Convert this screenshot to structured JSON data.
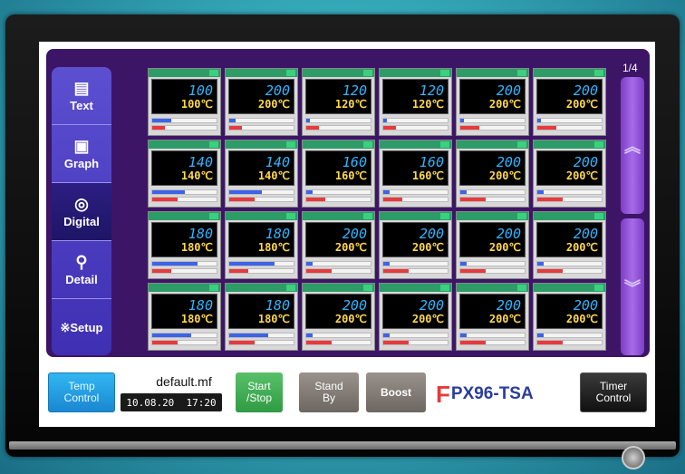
{
  "sidebar": {
    "items": [
      {
        "label": "Text",
        "icon": "text-icon",
        "glyph": "▤"
      },
      {
        "label": "Graph",
        "icon": "camera-icon",
        "glyph": "▣"
      },
      {
        "label": "Digital",
        "icon": "dial-icon",
        "glyph": "◎",
        "active": true
      },
      {
        "label": "Detail",
        "icon": "magnifier-icon",
        "glyph": "⚲"
      },
      {
        "label": "※Setup",
        "icon": "setup-icon",
        "glyph": ""
      }
    ]
  },
  "pager": {
    "page": "1/4",
    "up_glyph": "︽",
    "down_glyph": "︾"
  },
  "channels": [
    {
      "pv": "100",
      "sv": "100℃",
      "out1": 0.3,
      "out2": 0.2
    },
    {
      "pv": "200",
      "sv": "200℃",
      "out1": 0.1,
      "out2": 0.2
    },
    {
      "pv": "120",
      "sv": "120℃",
      "out1": 0.05,
      "out2": 0.2
    },
    {
      "pv": "120",
      "sv": "120℃",
      "out1": 0.05,
      "out2": 0.2
    },
    {
      "pv": "200",
      "sv": "200℃",
      "out1": 0.05,
      "out2": 0.3
    },
    {
      "pv": "200",
      "sv": "200℃",
      "out1": 0.05,
      "out2": 0.3
    },
    {
      "pv": "140",
      "sv": "140℃",
      "out1": 0.5,
      "out2": 0.4
    },
    {
      "pv": "140",
      "sv": "140℃",
      "out1": 0.5,
      "out2": 0.4
    },
    {
      "pv": "160",
      "sv": "160℃",
      "out1": 0.1,
      "out2": 0.3
    },
    {
      "pv": "160",
      "sv": "160℃",
      "out1": 0.1,
      "out2": 0.3
    },
    {
      "pv": "200",
      "sv": "200℃",
      "out1": 0.1,
      "out2": 0.4
    },
    {
      "pv": "200",
      "sv": "200℃",
      "out1": 0.1,
      "out2": 0.4
    },
    {
      "pv": "180",
      "sv": "180℃",
      "out1": 0.7,
      "out2": 0.3
    },
    {
      "pv": "180",
      "sv": "180℃",
      "out1": 0.7,
      "out2": 0.3
    },
    {
      "pv": "200",
      "sv": "200℃",
      "out1": 0.1,
      "out2": 0.4
    },
    {
      "pv": "200",
      "sv": "200℃",
      "out1": 0.1,
      "out2": 0.4
    },
    {
      "pv": "200",
      "sv": "200℃",
      "out1": 0.1,
      "out2": 0.4
    },
    {
      "pv": "200",
      "sv": "200℃",
      "out1": 0.1,
      "out2": 0.4
    },
    {
      "pv": "180",
      "sv": "180℃",
      "out1": 0.6,
      "out2": 0.4
    },
    {
      "pv": "180",
      "sv": "180℃",
      "out1": 0.6,
      "out2": 0.4
    },
    {
      "pv": "200",
      "sv": "200℃",
      "out1": 0.1,
      "out2": 0.4
    },
    {
      "pv": "200",
      "sv": "200℃",
      "out1": 0.1,
      "out2": 0.4
    },
    {
      "pv": "200",
      "sv": "200℃",
      "out1": 0.1,
      "out2": 0.4
    },
    {
      "pv": "200",
      "sv": "200℃",
      "out1": 0.1,
      "out2": 0.4
    }
  ],
  "bottom": {
    "temp_control": "Temp\nControl",
    "file_name": "default.mf",
    "datetime": "10.08.20  17:20",
    "start_stop": "Start\n/Stop",
    "stand_by": "Stand\nBy",
    "boost": "Boost",
    "logo_mark": "F",
    "logo_text": "PX96-TSA",
    "timer_control": "Timer\nControl"
  },
  "colors": {
    "purple_bg": "#3d1566",
    "sidebar": "#4b3dc0",
    "pv_text": "#2fb5ff",
    "sv_text": "#ffd94a",
    "cell_header": "#2d9c67",
    "bar_blue": "#3c63e8",
    "bar_red": "#e8393c"
  }
}
